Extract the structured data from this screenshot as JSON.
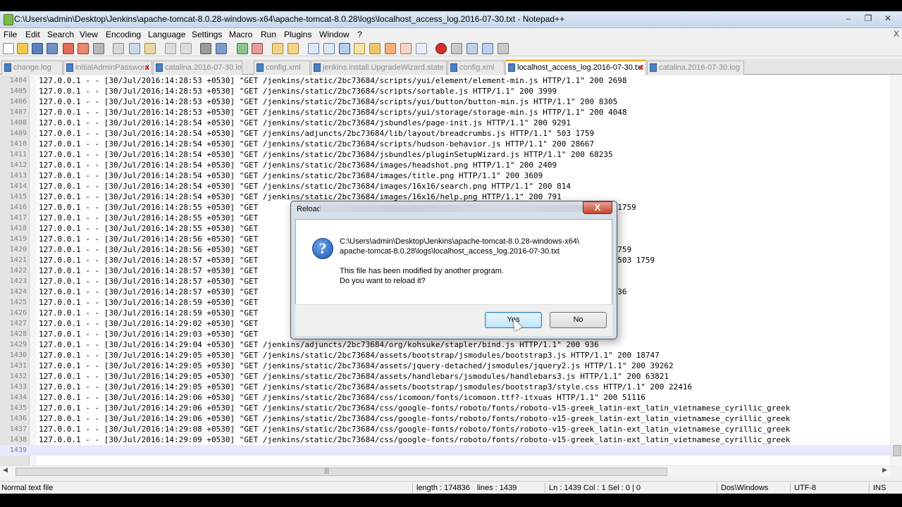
{
  "window": {
    "title": "C:\\Users\\admin\\Desktop\\Jenkins\\apache-tomcat-8.0.28-windows-x64\\apache-tomcat-8.0.28\\logs\\localhost_access_log.2016-07-30.txt - Notepad++",
    "min": "–",
    "max": "❐",
    "close": "✕"
  },
  "menu": {
    "items": [
      "File",
      "Edit",
      "Search",
      "View",
      "Encoding",
      "Language",
      "Settings",
      "Macro",
      "Run",
      "Plugins",
      "Window",
      "?"
    ],
    "close_glyph": "X"
  },
  "tabs": [
    {
      "label": "change.log",
      "active": false
    },
    {
      "label": "initialAdminPassword",
      "active": false,
      "close": "x"
    },
    {
      "label": "catalina.2016-07-30.log",
      "active": false
    },
    {
      "label": "config.xml",
      "active": false
    },
    {
      "label": "jenkins.install.UpgradeWizard.state",
      "active": false
    },
    {
      "label": "config.xml",
      "active": false
    },
    {
      "label": "localhost_access_log.2016-07-30.txt",
      "active": true,
      "close": "x"
    },
    {
      "label": "catalina.2016-07-30.log",
      "active": false
    }
  ],
  "lines": [
    {
      "n": "1404",
      "t": "127.0.0.1 - - [30/Jul/2016:14:28:53 +0530] \"GET /jenkins/static/2bc73684/scripts/yui/element/element-min.js HTTP/1.1\" 200 2698"
    },
    {
      "n": "1405",
      "t": "127.0.0.1 - - [30/Jul/2016:14:28:53 +0530] \"GET /jenkins/static/2bc73684/scripts/sortable.js HTTP/1.1\" 200 3999"
    },
    {
      "n": "1406",
      "t": "127.0.0.1 - - [30/Jul/2016:14:28:53 +0530] \"GET /jenkins/static/2bc73684/scripts/yui/button/button-min.js HTTP/1.1\" 200 8305"
    },
    {
      "n": "1407",
      "t": "127.0.0.1 - - [30/Jul/2016:14:28:53 +0530] \"GET /jenkins/static/2bc73684/scripts/yui/storage/storage-min.js HTTP/1.1\" 200 4048"
    },
    {
      "n": "1408",
      "t": "127.0.0.1 - - [30/Jul/2016:14:28:54 +0530] \"GET /jenkins/static/2bc73684/jsbundles/page-init.js HTTP/1.1\" 200 9291"
    },
    {
      "n": "1409",
      "t": "127.0.0.1 - - [30/Jul/2016:14:28:54 +0530] \"GET /jenkins/adjuncts/2bc73684/lib/layout/breadcrumbs.js HTTP/1.1\" 503 1759"
    },
    {
      "n": "1410",
      "t": "127.0.0.1 - - [30/Jul/2016:14:28:54 +0530] \"GET /jenkins/static/2bc73684/scripts/hudson-behavior.js HTTP/1.1\" 200 28667"
    },
    {
      "n": "1411",
      "t": "127.0.0.1 - - [30/Jul/2016:14:28:54 +0530] \"GET /jenkins/static/2bc73684/jsbundles/pluginSetupWizard.js HTTP/1.1\" 200 68235"
    },
    {
      "n": "1412",
      "t": "127.0.0.1 - - [30/Jul/2016:14:28:54 +0530] \"GET /jenkins/static/2bc73684/images/headshot.png HTTP/1.1\" 200 2409"
    },
    {
      "n": "1413",
      "t": "127.0.0.1 - - [30/Jul/2016:14:28:54 +0530] \"GET /jenkins/static/2bc73684/images/title.png HTTP/1.1\" 200 3609"
    },
    {
      "n": "1414",
      "t": "127.0.0.1 - - [30/Jul/2016:14:28:54 +0530] \"GET /jenkins/static/2bc73684/images/16x16/search.png HTTP/1.1\" 200 814"
    },
    {
      "n": "1415",
      "t": "127.0.0.1 - - [30/Jul/2016:14:28:54 +0530] \"GET /jenkins/static/2bc73684/images/16x16/help.png HTTP/1.1\" 200 791"
    },
    {
      "n": "1416",
      "t": "127.0.0.1 - - [30/Jul/2016:14:28:55 +0530] \"GET                                                       ery2.js HTTP/1.1\" 503 1759"
    },
    {
      "n": "1417",
      "t": "127.0.0.1 - - [30/Jul/2016:14:28:55 +0530] \"GET                                                       \" 503 1759"
    },
    {
      "n": "1418",
      "t": "127.0.0.1 - - [30/Jul/2016:14:28:55 +0530] \"GET                                                       \" 503 1759"
    },
    {
      "n": "1419",
      "t": "127.0.0.1 - - [30/Jul/2016:14:28:56 +0530] \"GET                                                       .js HTTP/1.1\" 503 1759"
    },
    {
      "n": "1420",
      "t": "127.0.0.1 - - [30/Jul/2016:14:28:56 +0530] \"GET                                                       rs3.js HTTP/1.1\" 503 1759"
    },
    {
      "n": "1421",
      "t": "127.0.0.1 - - [30/Jul/2016:14:28:57 +0530] \"GET                                                       3/style.css HTTP/1.1\" 503 1759"
    },
    {
      "n": "1422",
      "t": "127.0.0.1 - - [30/Jul/2016:14:28:57 +0530] \"GET                                                       ss HTTP/1.1\" 200 515"
    },
    {
      "n": "1423",
      "t": "127.0.0.1 - - [30/Jul/2016:14:28:57 +0530] \"GET                                                       \" 200 1415"
    },
    {
      "n": "1424",
      "t": "127.0.0.1 - - [30/Jul/2016:14:28:57 +0530] \"GET                                                       n.css HTTP/1.1\" 200 6636"
    },
    {
      "n": "1425",
      "t": "127.0.0.1 - - [30/Jul/2016:14:28:59 +0530] \"GET                                                       HTTP/1.1\" 200 348"
    },
    {
      "n": "1426",
      "t": "127.0.0.1 - - [30/Jul/2016:14:28:59 +0530] \"GET"
    },
    {
      "n": "1427",
      "t": "127.0.0.1 - - [30/Jul/2016:14:29:02 +0530] \"GET"
    },
    {
      "n": "1428",
      "t": "127.0.0.1 - - [30/Jul/2016:14:29:03 +0530] \"GET"
    },
    {
      "n": "1429",
      "t": "127.0.0.1 - - [30/Jul/2016:14:29:04 +0530] \"GET /jenkins/adjuncts/2bc73684/org/kohsuke/stapler/bind.js HTTP/1.1\" 200 936"
    },
    {
      "n": "1430",
      "t": "127.0.0.1 - - [30/Jul/2016:14:29:05 +0530] \"GET /jenkins/static/2bc73684/assets/bootstrap/jsmodules/bootstrap3.js HTTP/1.1\" 200 18747"
    },
    {
      "n": "1431",
      "t": "127.0.0.1 - - [30/Jul/2016:14:29:05 +0530] \"GET /jenkins/static/2bc73684/assets/jquery-detached/jsmodules/jquery2.js HTTP/1.1\" 200 39262"
    },
    {
      "n": "1432",
      "t": "127.0.0.1 - - [30/Jul/2016:14:29:05 +0530] \"GET /jenkins/static/2bc73684/assets/handlebars/jsmodules/handlebars3.js HTTP/1.1\" 200 63821"
    },
    {
      "n": "1433",
      "t": "127.0.0.1 - - [30/Jul/2016:14:29:05 +0530] \"GET /jenkins/static/2bc73684/assets/bootstrap/jsmodules/bootstrap3/style.css HTTP/1.1\" 200 22416"
    },
    {
      "n": "1434",
      "t": "127.0.0.1 - - [30/Jul/2016:14:29:06 +0530] \"GET /jenkins/static/2bc73684/css/icomoon/fonts/icomoon.ttf?-itxuas HTTP/1.1\" 200 51116"
    },
    {
      "n": "1435",
      "t": "127.0.0.1 - - [30/Jul/2016:14:29:06 +0530] \"GET /jenkins/static/2bc73684/css/google-fonts/roboto/fonts/roboto-v15-greek_latin-ext_latin_vietnamese_cyrillic_greek"
    },
    {
      "n": "1436",
      "t": "127.0.0.1 - - [30/Jul/2016:14:29:06 +0530] \"GET /jenkins/static/2bc73684/css/google-fonts/roboto/fonts/roboto-v15-greek_latin-ext_latin_vietnamese_cyrillic_greek"
    },
    {
      "n": "1437",
      "t": "127.0.0.1 - - [30/Jul/2016:14:29:08 +0530] \"GET /jenkins/static/2bc73684/css/google-fonts/roboto/fonts/roboto-v15-greek_latin-ext_latin_vietnamese_cyrillic_greek"
    },
    {
      "n": "1438",
      "t": "127.0.0.1 - - [30/Jul/2016:14:29:09 +0530] \"GET /jenkins/static/2bc73684/css/google-fonts/roboto/fonts/roboto-v15-greek_latin-ext_latin_vietnamese_cyrillic_greek"
    },
    {
      "n": "1439",
      "t": ""
    }
  ],
  "status": {
    "file_type": "Normal text file",
    "length": "length : 174836",
    "lines": "lines : 1439",
    "position": "Ln : 1439    Col : 1    Sel : 0 | 0",
    "eol": "Dos\\Windows",
    "encoding": "UTF-8",
    "mode": "INS"
  },
  "dialog": {
    "title": "Reload",
    "close": "X",
    "icon": "question-icon",
    "path_line1": "C:\\Users\\admin\\Desktop\\Jenkins\\apache-tomcat-8.0.28-windows-x64\\",
    "path_line2": "apache-tomcat-8.0.28\\logs\\localhost_access_log.2016-07-30.txt",
    "msg_line1": "This file has been modified by another program.",
    "msg_line2": "Do you want to reload it?",
    "yes": "Yes",
    "no": "No"
  },
  "colors": {
    "current_line": "#e8e8ff",
    "active_tab_accent": "#f5a623",
    "default_button": "#bee6fd"
  }
}
